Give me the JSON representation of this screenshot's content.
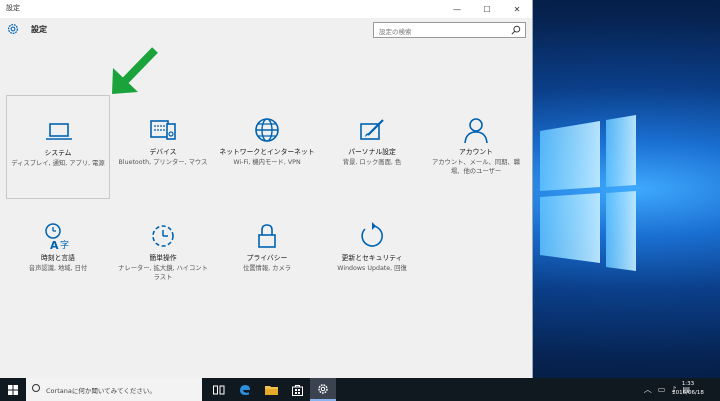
{
  "window": {
    "title": "設定",
    "app_title": "設定",
    "search_placeholder": "設定の検索",
    "min": "—",
    "max": "☐",
    "close": "✕"
  },
  "tiles": [
    {
      "name": "システム",
      "desc": "ディスプレイ, 通知, アプリ, 電源",
      "icon": "laptop-icon"
    },
    {
      "name": "デバイス",
      "desc": "Bluetooth, プリンター, マウス",
      "icon": "devices-icon"
    },
    {
      "name": "ネットワークとインターネット",
      "desc": "Wi-Fi, 機内モード, VPN",
      "icon": "globe-icon"
    },
    {
      "name": "パーソナル設定",
      "desc": "背景, ロック画面, 色",
      "icon": "personalization-icon"
    },
    {
      "name": "アカウント",
      "desc": "アカウント、メール、同期、職場、他のユーザー",
      "icon": "person-icon"
    },
    {
      "name": "時刻と言語",
      "desc": "音声認識, 地域, 日付",
      "icon": "time-language-icon"
    },
    {
      "name": "簡単操作",
      "desc": "ナレーター, 拡大鏡, ハイコントラスト",
      "icon": "ease-of-access-icon"
    },
    {
      "name": "プライバシー",
      "desc": "位置情報, カメラ",
      "icon": "lock-icon"
    },
    {
      "name": "更新とセキュリティ",
      "desc": "Windows Update, 回復",
      "icon": "update-icon"
    }
  ],
  "taskbar": {
    "cortana_placeholder": "Cortanaに何か聞いてみてください。",
    "time": "1:33",
    "date": "2016/06/18"
  },
  "colors": {
    "accent": "#0063b1",
    "arrow": "#1aa33a"
  }
}
